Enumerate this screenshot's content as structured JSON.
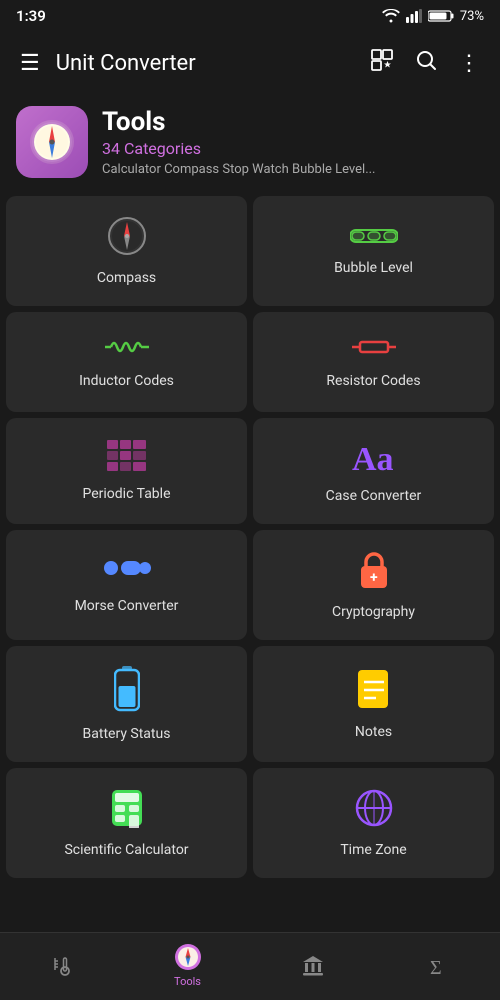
{
  "statusBar": {
    "time": "1:39",
    "battery": "73%"
  },
  "topBar": {
    "title": "Unit Converter",
    "hamburgerIcon": "☰",
    "gridStarIcon": "⊞",
    "searchIcon": "🔍",
    "moreIcon": "⋮"
  },
  "hero": {
    "title": "Tools",
    "subtitle": "34 Categories",
    "description": "Calculator Compass Stop Watch Bubble Level..."
  },
  "grid": [
    {
      "id": "compass",
      "label": "Compass",
      "icon": "🧭",
      "iconColor": "#e84040"
    },
    {
      "id": "bubble-level",
      "label": "Bubble Level",
      "icon": "bubble",
      "iconColor": "#55cc44"
    },
    {
      "id": "inductor-codes",
      "label": "Inductor Codes",
      "icon": "inductor",
      "iconColor": "#55cc44"
    },
    {
      "id": "resistor-codes",
      "label": "Resistor Codes",
      "icon": "resistor",
      "iconColor": "#e84040"
    },
    {
      "id": "periodic-table",
      "label": "Periodic Table",
      "icon": "periodic",
      "iconColor": "#e040bb"
    },
    {
      "id": "case-converter",
      "label": "Case Converter",
      "icon": "Aa",
      "iconColor": "#9955ff"
    },
    {
      "id": "morse-converter",
      "label": "Morse Converter",
      "icon": "morse",
      "iconColor": "#5588ff"
    },
    {
      "id": "cryptography",
      "label": "Cryptography",
      "icon": "🔒",
      "iconColor": "#ff6644"
    },
    {
      "id": "battery-status",
      "label": "Battery Status",
      "icon": "battery",
      "iconColor": "#44bbff"
    },
    {
      "id": "notes",
      "label": "Notes",
      "icon": "notes",
      "iconColor": "#ffcc00"
    },
    {
      "id": "scientific-calculator",
      "label": "Scientific Calculator",
      "icon": "calc",
      "iconColor": "#44dd55"
    },
    {
      "id": "time-zone",
      "label": "Time Zone",
      "icon": "🌐",
      "iconColor": "#9955ff"
    }
  ],
  "bottomNav": [
    {
      "id": "thermometer",
      "icon": "thermometer",
      "label": "",
      "active": false
    },
    {
      "id": "tools",
      "icon": "compass",
      "label": "Tools",
      "active": true
    },
    {
      "id": "bank",
      "icon": "bank",
      "label": "",
      "active": false
    },
    {
      "id": "sigma",
      "icon": "sigma",
      "label": "",
      "active": false
    }
  ]
}
